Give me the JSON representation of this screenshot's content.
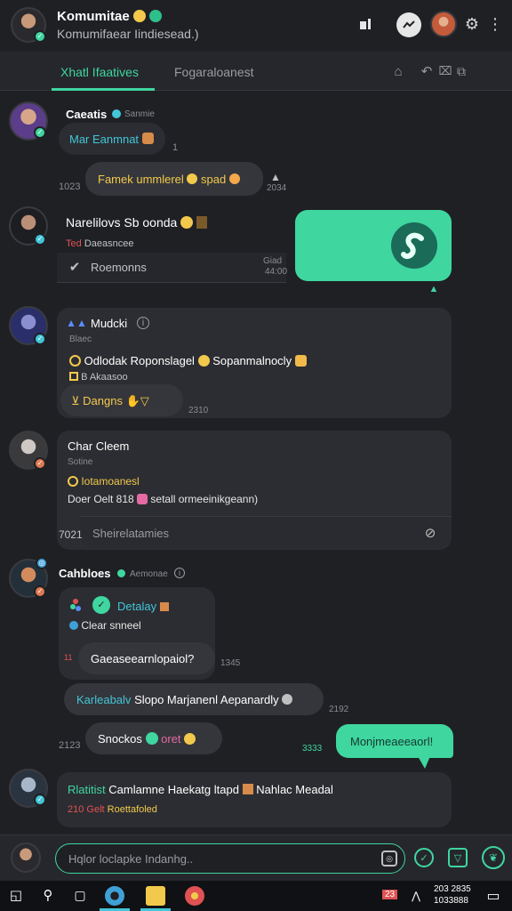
{
  "header": {
    "title": "Komumitae",
    "subtitle": "Komumifaear Iindiesead.)"
  },
  "tabs": [
    {
      "label": "Xhatl Ifaatives"
    },
    {
      "label": "Fogaraloanest"
    }
  ],
  "colors": {
    "accent": "#3fd6a0",
    "bg": "#1f2024",
    "bubble": "#2c2d32",
    "yellow": "#f2c94c",
    "cyan": "#42c6d8"
  },
  "messages": {
    "m1": {
      "name": "Caeatis",
      "tag": "Sanmie",
      "text": "Mar Eanmnat"
    },
    "m2": {
      "text": "Famek ummlerel",
      "tail": "spad",
      "time": "1023",
      "count": "2034"
    },
    "m3": {
      "name": "Narelilovs Sb oonda",
      "sub1": "Daeasncee",
      "sub1_prefix": "Ted",
      "sub2": "Roemonns",
      "time": "Giad",
      "time2": "44:00"
    },
    "m4": {
      "name": "Mudcki",
      "sub": "Blaec",
      "line": "Odlodak Roponslagel",
      "line_tail": "Sopanmalnocly",
      "sub2": "B Akaasoo",
      "chip": "Dangns",
      "time": "2310"
    },
    "m5": {
      "name": "Char Cleem",
      "sub": "Sotine",
      "line1": "Iotamoanesl",
      "line2_pre": "Doer Oelt 818",
      "line2_post": "setall ormeeinikgeann)",
      "time": "7021"
    },
    "input_inline": {
      "placeholder": "Sheirelatamies"
    },
    "m6": {
      "name": "Cahbloes",
      "tag": "Aemonae",
      "app": "Detalay",
      "sub": "Clear snneel",
      "reply": "Gaeaseearnlopaiol?",
      "time": "1345",
      "marker": "11"
    },
    "m7": {
      "highlight": "Karleabalv",
      "text": "Slopo Marjanenl Aepanardly",
      "time": "2192"
    },
    "m8": {
      "text": "Snockos",
      "tail": "oret",
      "time": "2123"
    },
    "m9": {
      "text": "Monjmeaeeaorl!",
      "time": "3333"
    },
    "m10": {
      "highlight": "Rlatitist",
      "text": "Camlamne Haekatg ltapd",
      "tail": "Nahlac Meadal",
      "sub_pre": "210 Gelt",
      "sub": "Roettafoled"
    }
  },
  "composer": {
    "placeholder": "Hqlor loclapke Indanhg.."
  },
  "taskbar": {
    "date1": "203 2835",
    "date2": "1033888",
    "indicator": "23"
  }
}
